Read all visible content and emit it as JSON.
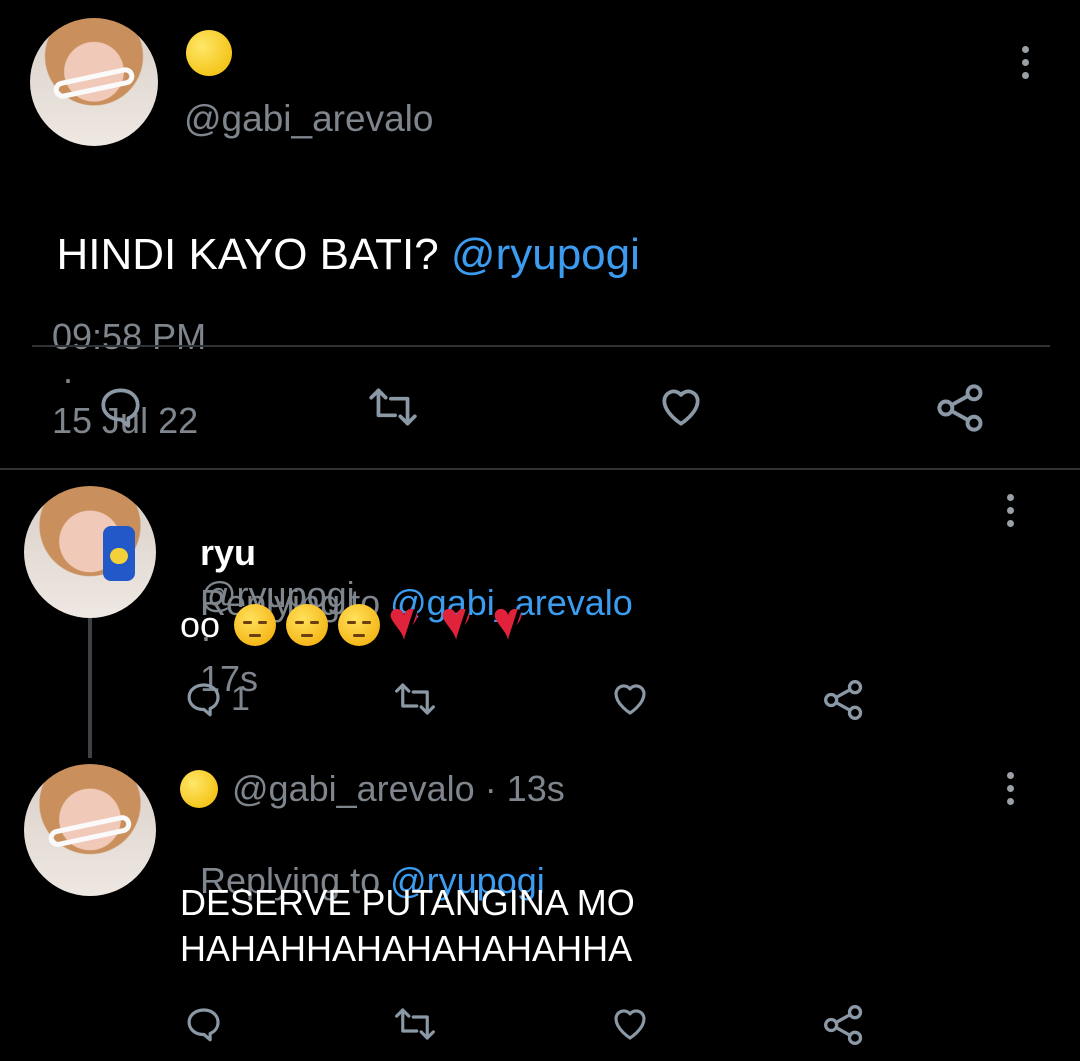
{
  "main_tweet": {
    "display_name_icon": "full-moon-emoji",
    "handle": "@gabi_arevalo",
    "text_plain": "HINDI KAYO BATI? ",
    "text_mention": "@ryupogi",
    "time": "09:58 PM",
    "separator": "·",
    "date": "15 Jul 22"
  },
  "replies": [
    {
      "display_name": "ryu",
      "handle": "@ryupogi",
      "separator": "·",
      "age": "17s",
      "replying_prefix": "Replying to ",
      "replying_handle": "@gabi_arevalo",
      "text": "oo",
      "emojis": [
        "pensive-face",
        "pensive-face",
        "pensive-face",
        "broken-heart",
        "broken-heart",
        "broken-heart"
      ],
      "reply_count": "1"
    },
    {
      "display_name_icon": "full-moon-emoji",
      "handle": "@gabi_arevalo",
      "separator": "·",
      "age": "13s",
      "replying_prefix": "Replying to ",
      "replying_handle": "@ryupogi",
      "text_line1": "DESERVE PUTANGINA MO",
      "text_line2": "HAHAHHAHAHAHAHAHHA"
    }
  ],
  "colors": {
    "background": "#000000",
    "text": "#e7e9ea",
    "muted": "#7e858c",
    "link": "#3b9cf0",
    "divider": "#2f3336"
  }
}
